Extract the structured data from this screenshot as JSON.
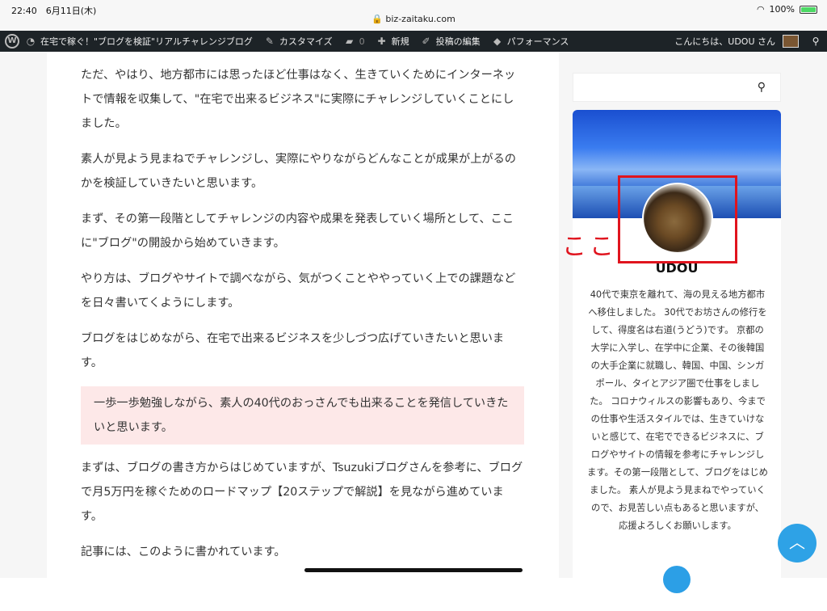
{
  "status": {
    "time": "22:40　6月11日(木)",
    "domain": "biz-zaitaku.com",
    "battery": "100%"
  },
  "admin_bar": {
    "site_name": "在宅で稼ぐ！\"ブログを検証\"リアルチャレンジブログ",
    "customize": "カスタマイズ",
    "comments_count": "0",
    "new": "新規",
    "edit_post": "投稿の編集",
    "performance": "パフォーマンス",
    "greeting": "こんにちは、UDOU さん"
  },
  "post": {
    "p1": "ただ、やはり、地方都市には思ったほど仕事はなく、生きていくためにインターネットで情報を収集して、\"在宅で出来るビジネス\"に実際にチャレンジしていくことにしました。",
    "p2": "素人が見よう見まねでチャレンジし、実際にやりながらどんなことが成果が上がるのかを検証していきたいと思います。",
    "p3": "まず、その第一段階としてチャレンジの内容や成果を発表していく場所として、ここに\"ブログ\"の開設から始めていきます。",
    "p4": "やり方は、ブログやサイトで調べながら、気がつくことややっていく上での課題などを日々書いてくようにします。",
    "p5": "ブログをはじめながら、在宅で出来るビジネスを少しづつ広げていきたいと思います。",
    "highlight": "一歩一歩勉強しながら、素人の40代のおっさんでも出来ることを発信していきたいと思います。",
    "p6": "まずは、ブログの書き方からはじめていますが、Tsuzukiブログさんを参考に、ブログで月5万円を稼ぐためのロードマップ【20ステップで解説】を見ながら進めています。",
    "p7": "記事には、このように書かれています。"
  },
  "sidebar": {
    "profile_name": "UDOU",
    "bio": "40代で東京を離れて、海の見える地方都市へ移住しました。 30代でお坊さんの修行をして、得度名は右道(うどう)です。 京都の大学に入学し、在学中に企業、その後韓国の大手企業に就職し、韓国、中国、シンガポール、タイとアジア圏で仕事をしました。 コロナウィルスの影響もあり、今までの仕事や生活スタイルでは、生きていけないと感じて、在宅でできるビジネスに、ブログやサイトの情報を参考にチャレンジします。その第一段階として、ブログをはじめました。 素人が見よう見まねでやっていくので、お見苦しい点もあると思いますが、応援よろしくお願いします。"
  },
  "annotation": {
    "label": "ここ",
    "color": "#e0141e"
  },
  "colors": {
    "admin_bar": "#1d2327",
    "highlight_bg": "#fde8e8",
    "accent": "#2ea2e6"
  },
  "icons": [
    "wordpress-icon",
    "dashboard-icon",
    "brush-icon",
    "comment-icon",
    "plus-icon",
    "pencil-icon",
    "performance-icon",
    "search-icon",
    "twitter-icon",
    "chevron-up-icon",
    "wifi-icon",
    "battery-icon"
  ]
}
